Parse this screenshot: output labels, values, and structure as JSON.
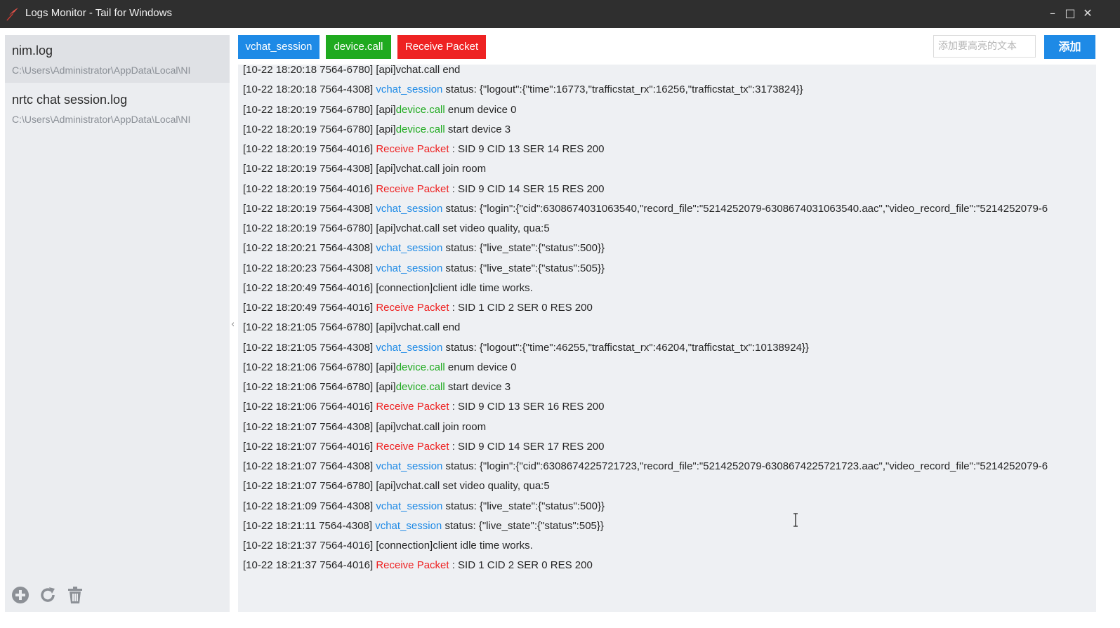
{
  "window": {
    "title": "Logs Monitor - Tail for Windows",
    "controls": {
      "minimize": "–",
      "maximize": "□",
      "close": "✕"
    }
  },
  "sidebar": {
    "files": [
      {
        "name": "nim.log",
        "path": "C:\\Users\\Administrator\\AppData\\Local\\NI",
        "selected": true
      },
      {
        "name": "nrtc chat session.log",
        "path": "C:\\Users\\Administrator\\AppData\\Local\\NI",
        "selected": false
      }
    ],
    "actions": [
      "plus-circle-icon",
      "refresh-icon",
      "trash-icon"
    ]
  },
  "toolbar": {
    "tags": [
      {
        "label": "vchat_session",
        "color": "#1e8ae6"
      },
      {
        "label": "device.call",
        "color": "#1faa1f"
      },
      {
        "label": "Receive Packet",
        "color": "#ee2222"
      }
    ],
    "highlight_input": {
      "placeholder": "添加要高亮的文本",
      "value": ""
    },
    "add_label": "添加"
  },
  "log": {
    "lines": [
      {
        "prefix": "[10-22 18:20:18 7564-6780] [api]vchat.call end",
        "highlight": "",
        "type": "",
        "suffix": ""
      },
      {
        "prefix": "[10-22 18:20:18 7564-4308] ",
        "highlight": "vchat_session",
        "type": "blue",
        "suffix": " status: {\"logout\":{\"time\":16773,\"trafficstat_rx\":16256,\"trafficstat_tx\":3173824}}"
      },
      {
        "prefix": "[10-22 18:20:19 7564-6780] [api]",
        "highlight": "device.call",
        "type": "green",
        "suffix": " enum device 0"
      },
      {
        "prefix": "[10-22 18:20:19 7564-6780] [api]",
        "highlight": "device.call",
        "type": "green",
        "suffix": " start device 3"
      },
      {
        "prefix": "[10-22 18:20:19 7564-4016] ",
        "highlight": "Receive Packet",
        "type": "red",
        "suffix": " : SID 9 CID 13 SER 14 RES 200"
      },
      {
        "prefix": "[10-22 18:20:19 7564-4308] [api]vchat.call join room",
        "highlight": "",
        "type": "",
        "suffix": ""
      },
      {
        "prefix": "[10-22 18:20:19 7564-4016] ",
        "highlight": "Receive Packet",
        "type": "red",
        "suffix": " : SID 9 CID 14 SER 15 RES 200"
      },
      {
        "prefix": "[10-22 18:20:19 7564-4308] ",
        "highlight": "vchat_session",
        "type": "blue",
        "suffix": " status: {\"login\":{\"cid\":6308674031063540,\"record_file\":\"5214252079-6308674031063540.aac\",\"video_record_file\":\"5214252079-6"
      },
      {
        "prefix": "[10-22 18:20:19 7564-6780] [api]vchat.call set video quality, qua:5",
        "highlight": "",
        "type": "",
        "suffix": ""
      },
      {
        "prefix": "[10-22 18:20:21 7564-4308] ",
        "highlight": "vchat_session",
        "type": "blue",
        "suffix": " status: {\"live_state\":{\"status\":500}}"
      },
      {
        "prefix": "[10-22 18:20:23 7564-4308] ",
        "highlight": "vchat_session",
        "type": "blue",
        "suffix": " status: {\"live_state\":{\"status\":505}}"
      },
      {
        "prefix": "[10-22 18:20:49 7564-4016] [connection]client idle time works.",
        "highlight": "",
        "type": "",
        "suffix": ""
      },
      {
        "prefix": "[10-22 18:20:49 7564-4016] ",
        "highlight": "Receive Packet",
        "type": "red",
        "suffix": " : SID 1 CID 2 SER 0 RES 200"
      },
      {
        "prefix": "[10-22 18:21:05 7564-6780] [api]vchat.call end",
        "highlight": "",
        "type": "",
        "suffix": ""
      },
      {
        "prefix": "[10-22 18:21:05 7564-4308] ",
        "highlight": "vchat_session",
        "type": "blue",
        "suffix": " status: {\"logout\":{\"time\":46255,\"trafficstat_rx\":46204,\"trafficstat_tx\":10138924}}"
      },
      {
        "prefix": "[10-22 18:21:06 7564-6780] [api]",
        "highlight": "device.call",
        "type": "green",
        "suffix": " enum device 0"
      },
      {
        "prefix": "[10-22 18:21:06 7564-6780] [api]",
        "highlight": "device.call",
        "type": "green",
        "suffix": " start device 3"
      },
      {
        "prefix": "[10-22 18:21:06 7564-4016] ",
        "highlight": "Receive Packet",
        "type": "red",
        "suffix": " : SID 9 CID 13 SER 16 RES 200"
      },
      {
        "prefix": "[10-22 18:21:07 7564-4308] [api]vchat.call join room",
        "highlight": "",
        "type": "",
        "suffix": ""
      },
      {
        "prefix": "[10-22 18:21:07 7564-4016] ",
        "highlight": "Receive Packet",
        "type": "red",
        "suffix": " : SID 9 CID 14 SER 17 RES 200"
      },
      {
        "prefix": "[10-22 18:21:07 7564-4308] ",
        "highlight": "vchat_session",
        "type": "blue",
        "suffix": " status: {\"login\":{\"cid\":6308674225721723,\"record_file\":\"5214252079-6308674225721723.aac\",\"video_record_file\":\"5214252079-6"
      },
      {
        "prefix": "[10-22 18:21:07 7564-6780] [api]vchat.call set video quality, qua:5",
        "highlight": "",
        "type": "",
        "suffix": ""
      },
      {
        "prefix": "[10-22 18:21:09 7564-4308] ",
        "highlight": "vchat_session",
        "type": "blue",
        "suffix": " status: {\"live_state\":{\"status\":500}}"
      },
      {
        "prefix": "[10-22 18:21:11 7564-4308] ",
        "highlight": "vchat_session",
        "type": "blue",
        "suffix": " status: {\"live_state\":{\"status\":505}}"
      },
      {
        "prefix": "[10-22 18:21:37 7564-4016] [connection]client idle time works.",
        "highlight": "",
        "type": "",
        "suffix": ""
      },
      {
        "prefix": "[10-22 18:21:37 7564-4016] ",
        "highlight": "Receive Packet",
        "type": "red",
        "suffix": " : SID 1 CID 2 SER 0 RES 200"
      }
    ]
  },
  "colors": {
    "titlebar": "#2f2f2f",
    "accent": "#1e8ae6",
    "green": "#1faa1f",
    "red": "#ee2222"
  }
}
